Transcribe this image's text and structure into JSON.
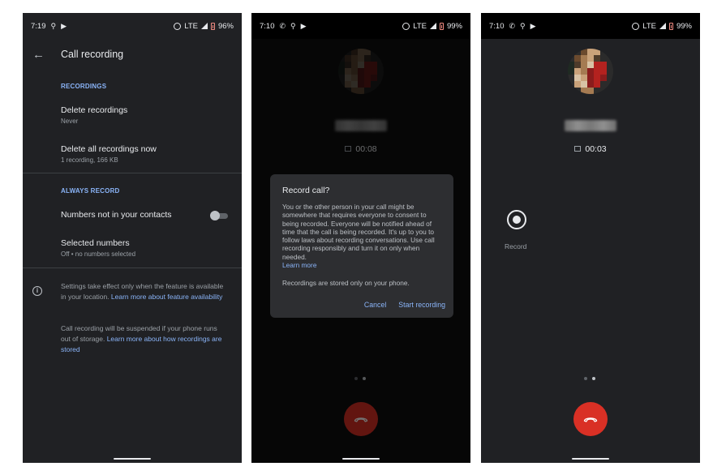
{
  "screens": [
    {
      "status": {
        "time": "7:19",
        "network": "LTE",
        "battery": "96%"
      },
      "appbar": {
        "title": "Call recording"
      },
      "sections": [
        {
          "header": "RECORDINGS",
          "items": [
            {
              "title": "Delete recordings",
              "subtitle": "Never"
            },
            {
              "title": "Delete all recordings now",
              "subtitle": "1 recording, 166 KB"
            }
          ]
        },
        {
          "header": "ALWAYS RECORD",
          "items": [
            {
              "title": "Numbers not in your contacts",
              "toggle": false
            },
            {
              "title": "Selected numbers",
              "subtitle": "Off • no numbers selected"
            }
          ]
        }
      ],
      "info": [
        {
          "text": "Settings take effect only when the feature is available in your location. ",
          "link": "Learn more about feature availability"
        },
        {
          "text": "Call recording will be suspended if your phone runs out of storage. ",
          "link": "Learn more about how recordings are stored"
        }
      ]
    },
    {
      "status": {
        "time": "7:10",
        "network": "LTE",
        "battery": "99%"
      },
      "call": {
        "duration": "00:08"
      },
      "dialog": {
        "title": "Record call?",
        "body": "You or the other person in your call might be somewhere that requires everyone to consent to being recorded. Everyone will be notified ahead of time that the call is being recorded. It's up to you to follow laws about recording conversations. Use call recording responsibly and turn it on only when needed.",
        "link": "Learn more",
        "note": "Recordings are stored only on your phone.",
        "cancel": "Cancel",
        "confirm": "Start recording"
      },
      "pager": {
        "pages": 2,
        "active": 2
      }
    },
    {
      "status": {
        "time": "7:10",
        "network": "LTE",
        "battery": "99%"
      },
      "call": {
        "duration": "00:03"
      },
      "record_label": "Record",
      "pager": {
        "pages": 2,
        "active": 2
      },
      "colors": {
        "end_call": "#d93025"
      }
    }
  ]
}
